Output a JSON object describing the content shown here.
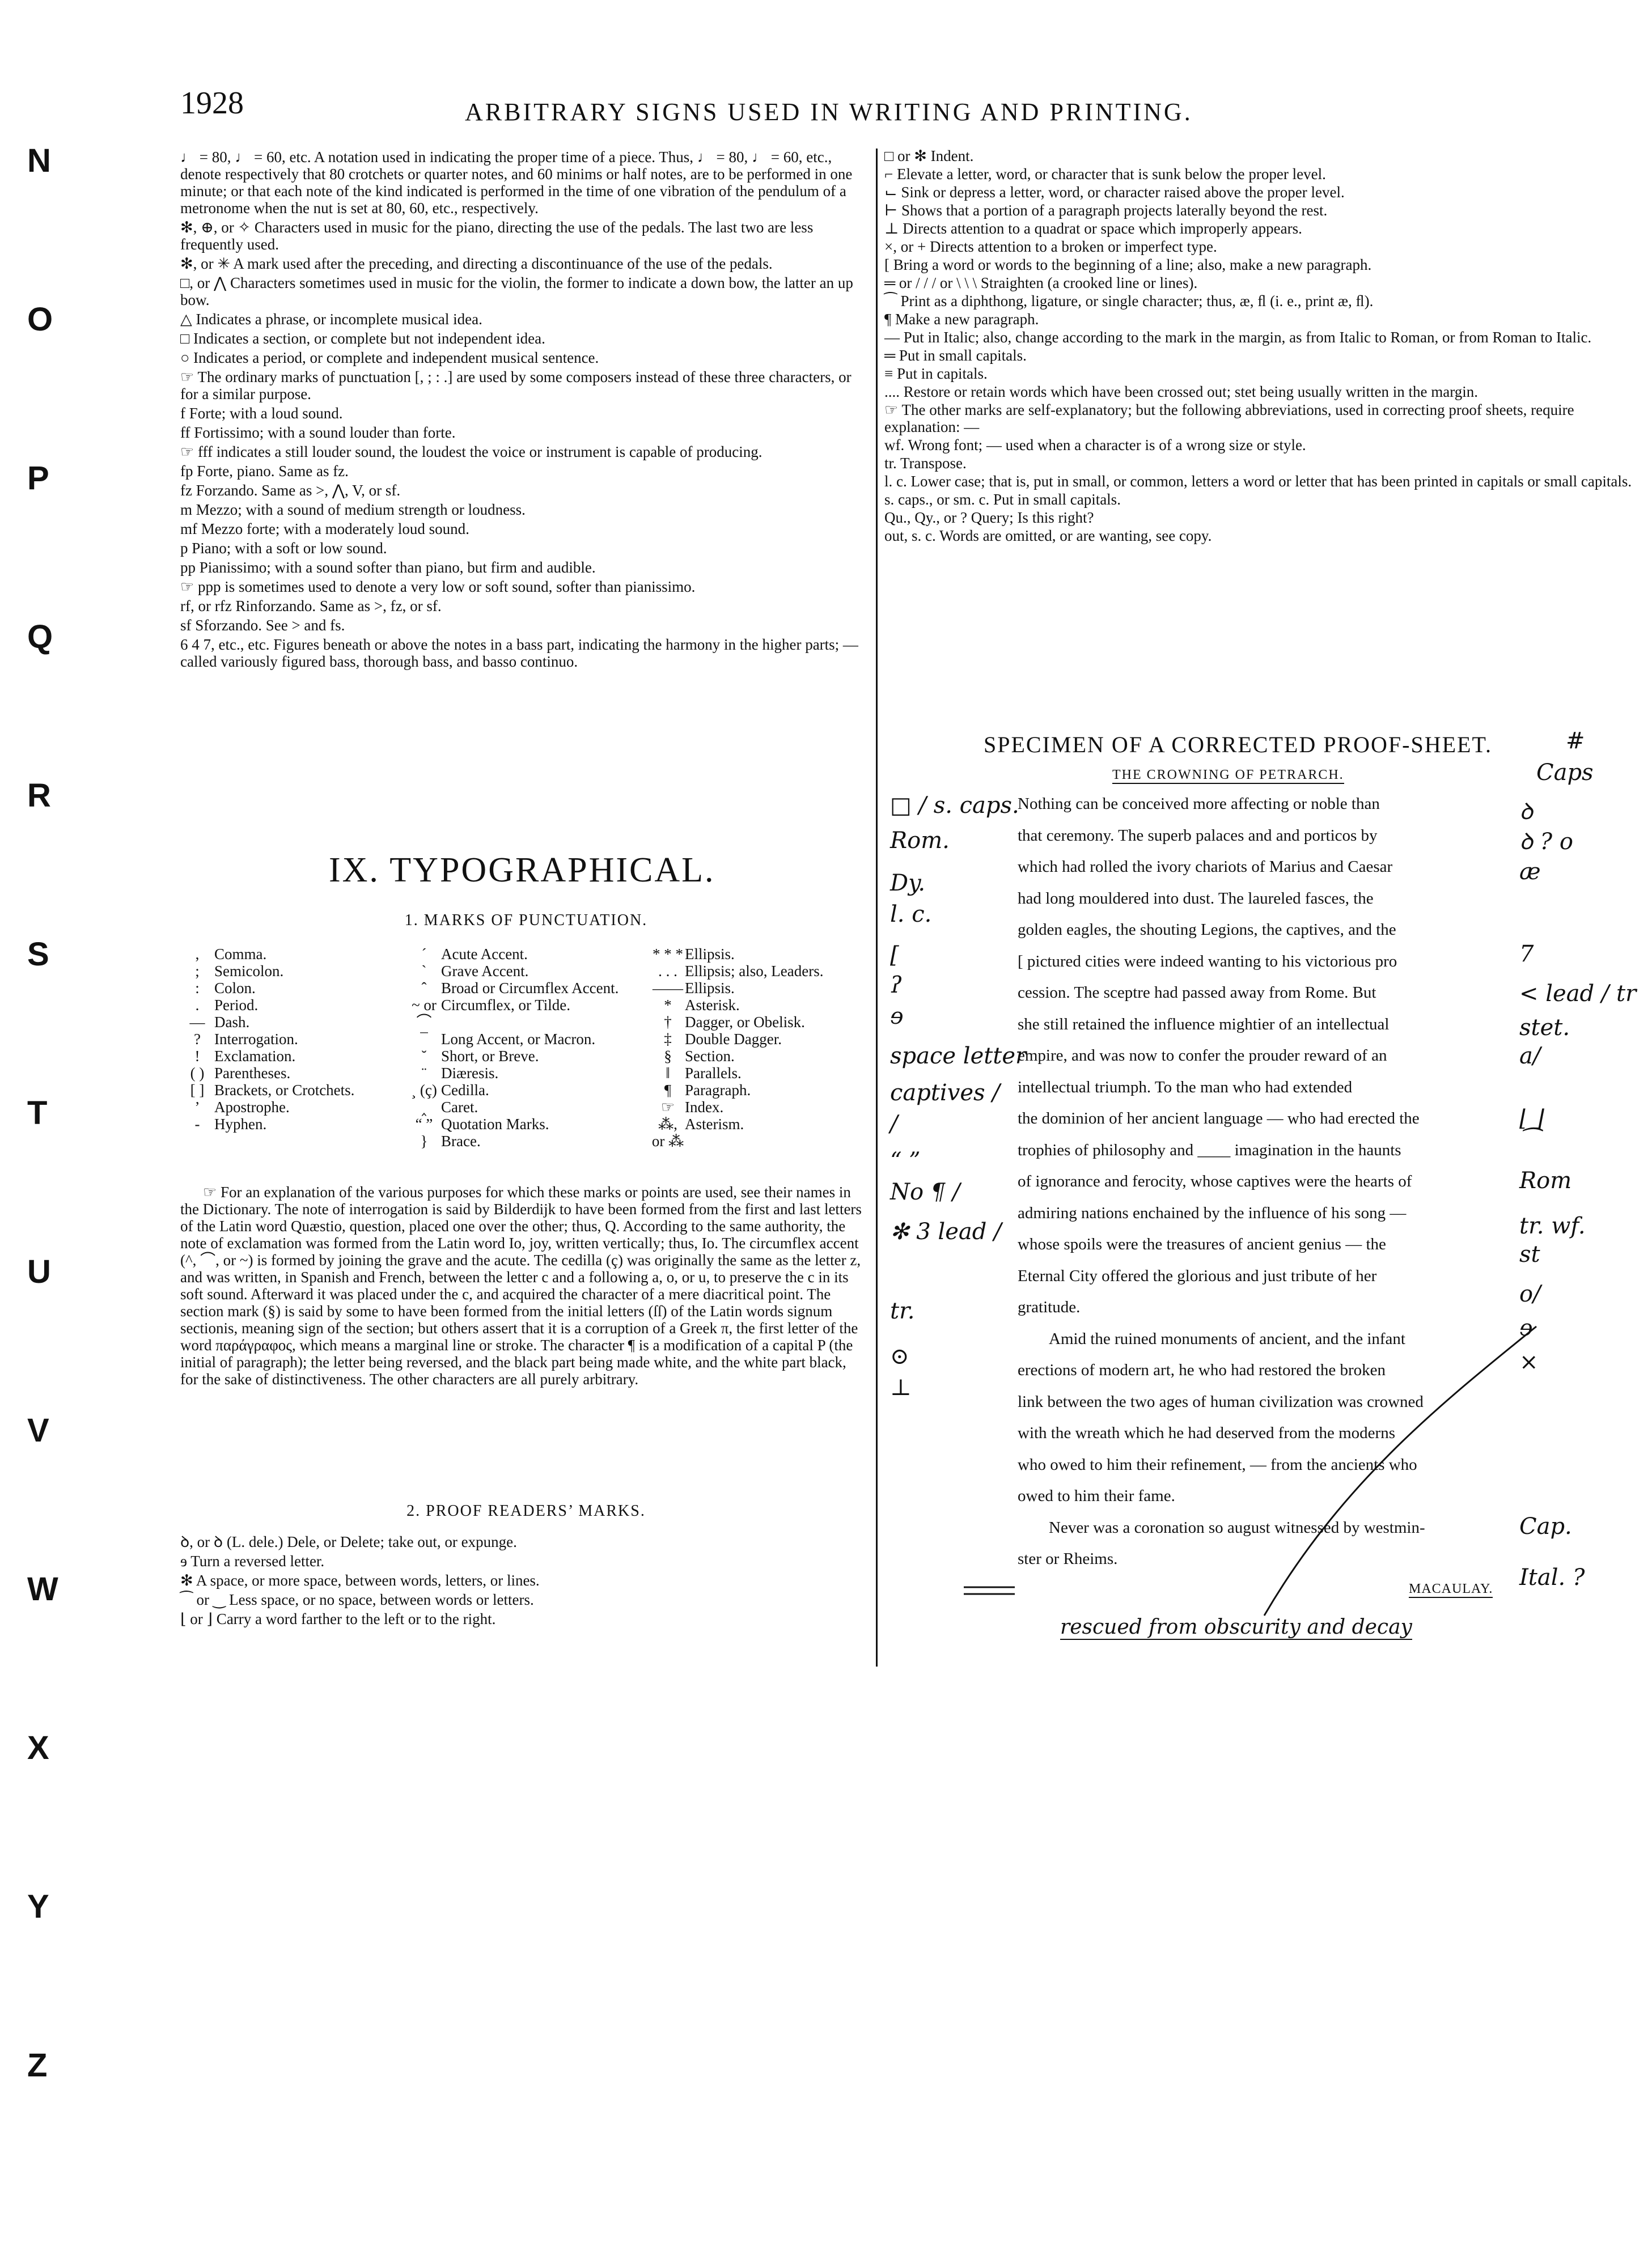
{
  "header": {
    "page_number": "1928",
    "running_head": "ARBITRARY SIGNS USED IN WRITING AND PRINTING."
  },
  "thumb_index": [
    "N",
    "O",
    "P",
    "Q",
    "R",
    "S",
    "T",
    "U",
    "V",
    "W",
    "X",
    "Y",
    "Z"
  ],
  "left_column": {
    "music": [
      "♩ = 80, ♩ = 60, etc.   A notation used in indicating the proper time of a piece. Thus, ♩ = 80, ♩ = 60, etc., denote respectively that 80 crotchets or quarter notes, and 60 minims or half notes, are to be performed in one minute; or that each note of the kind indicated is performed in the time of one vibration of the pendulum of a metronome when the nut is set at 80, 60, etc., respectively.",
      "✻, ⊕, or ✧   Characters used in music for the piano, directing the use of the pedals. The last two are less frequently used.",
      "✻, or ✳   A mark used after the preceding, and directing a discontinuance of the use of the pedals.",
      "□, or ⋀   Characters sometimes used in music for the violin, the former to indicate a down bow, the latter an up bow.",
      "△  Indicates a phrase, or incomplete musical idea.",
      "□  Indicates a section, or complete but not independent idea.",
      "○  Indicates a period, or complete and independent musical sentence.",
      "☞ The ordinary marks of punctuation [, ; : .] are used by some composers instead of these three characters, or for a similar purpose.",
      "f   Forte; with a loud sound.",
      "ff  Fortissimo; with a sound louder than forte.",
      "☞ fff indicates a still louder sound, the loudest the voice or instrument is capable of producing.",
      "fp  Forte, piano. Same as fz.",
      "fz  Forzando. Same as >, ⋀, V, or sf.",
      "m  Mezzo; with a sound of medium strength or loudness.",
      "mf  Mezzo forte; with a moderately loud sound.",
      "p  Piano; with a soft or low sound.",
      "pp  Pianissimo; with a sound softer than piano, but firm and audible.",
      "☞ ppp is sometimes used to denote a very low or soft sound, softer than pianissimo.",
      "rf, or rfz  Rinforzando. Same as >, fz, or sf.",
      "sf  Sforzando. See > and fs.",
      "6 4 7, etc., etc.  Figures beneath or above the notes in a bass part, indicating the harmony in the higher parts; — called variously figured bass, thorough bass, and basso continuo."
    ],
    "section_title": "IX. TYPOGRAPHICAL.",
    "sub1": "1. MARKS OF PUNCTUATION.",
    "punct_col1": [
      [
        ",",
        "Comma."
      ],
      [
        ";",
        "Semicolon."
      ],
      [
        ":",
        "Colon."
      ],
      [
        ".",
        "Period."
      ],
      [
        "—",
        "Dash."
      ],
      [
        "?",
        "Interrogation."
      ],
      [
        "!",
        "Exclamation."
      ],
      [
        "( )",
        "Parentheses."
      ],
      [
        "[ ]",
        "Brackets, or Crotchets."
      ],
      [
        "’",
        "Apostrophe."
      ],
      [
        "-",
        "Hyphen."
      ]
    ],
    "punct_col2": [
      [
        "´",
        "Acute Accent."
      ],
      [
        "`",
        "Grave Accent."
      ],
      [
        "ˆ",
        "Broad or Circumflex Accent."
      ],
      [
        "~ or ⌒",
        "Circumflex, or Tilde."
      ],
      [
        "¯",
        "Long Accent, or Macron."
      ],
      [
        "˘",
        "Short, or Breve."
      ],
      [
        "¨",
        "Diæresis."
      ],
      [
        "¸ (ç)",
        "Cedilla."
      ],
      [
        "‸",
        "Caret."
      ],
      [
        "“ ”",
        "Quotation Marks."
      ],
      [
        "}",
        "Brace."
      ]
    ],
    "punct_col3": [
      [
        "* * *",
        "Ellipsis."
      ],
      [
        ". . .",
        "Ellipsis; also, Leaders."
      ],
      [
        "——",
        "Ellipsis."
      ],
      [
        "*",
        "Asterisk."
      ],
      [
        "†",
        "Dagger, or Obelisk."
      ],
      [
        "‡",
        "Double Dagger."
      ],
      [
        "§",
        "Section."
      ],
      [
        "‖",
        "Parallels."
      ],
      [
        "¶",
        "Paragraph."
      ],
      [
        "☞",
        "Index."
      ],
      [
        "⁂, or ⁂",
        "Asterism."
      ]
    ],
    "explanation": "☞ For an explanation of the various purposes for which these marks or points are used, see their names in the Dictionary. The note of interrogation is said by Bilderdijk to have been formed from the first and last letters of the Latin word Quæstio, question, placed one over the other; thus, Q. According to the same authority, the note of exclamation was formed from the Latin word Io, joy, written vertically; thus, Io. The circumflex accent (^, ⌒, or ~) is formed by joining the grave and the acute. The cedilla (ç) was originally the same as the letter z, and was written, in Spanish and French, between the letter c and a following a, o, or u, to preserve the c in its soft sound. Afterward it was placed under the c, and acquired the character of a mere diacritical point. The section mark (§) is said by some to have been formed from the initial letters (ſſ) of the Latin words signum sectionis, meaning sign of the section; but others assert that it is a corruption of a Greek π, the first letter of the word παράγραφος, which means a marginal line or stroke. The character ¶ is a modification of a capital P (the initial of paragraph); the letter being reversed, and the black part being made white, and the white part black, for the sake of distinctiveness. The other characters are all purely arbitrary.",
    "sub2": "2. PROOF READERS’ MARKS.",
    "proof_marks": [
      "ꝺ, or ꝺ  (L. dele.)  Dele, or Delete; take out, or expunge.",
      "ɘ  Turn a reversed letter.",
      "✻  A space, or more space, between words, letters, or lines.",
      "⁀ or ‿  Less space, or no space, between words or letters.",
      "⌊ or ⌋  Carry a word farther to the left or to the right."
    ]
  },
  "right_column": {
    "marks": [
      "□ or ✻  Indent.",
      "⌐  Elevate a letter, word, or character that is sunk below the proper level.",
      "⌙  Sink or depress a letter, word, or character raised above the proper level.",
      "⊢  Shows that a portion of a paragraph projects laterally beyond the rest.",
      "⊥  Directs attention to a quadrat or space which improperly appears.",
      "×, or +  Directs attention to a broken or imperfect type.",
      "[  Bring a word or words to the beginning of a line; also, make a new paragraph.",
      "═ or / / / or \\ \\ \\  Straighten (a crooked line or lines).",
      "⁀  Print as a diphthong, ligature, or single character; thus, æ, ﬂ (i. e., print æ, ﬂ).",
      "¶  Make a new paragraph.",
      "—  Put in Italic; also, change according to the mark in the margin, as from Italic to Roman, or from Roman to Italic.",
      "═  Put in small capitals.",
      "≡  Put in capitals.",
      "....  Restore or retain words which have been crossed out; stet being usually written in the margin.",
      "☞ The other marks are self-explanatory; but the following abbreviations, used in correcting proof sheets, require explanation: —",
      "wf.  Wrong font; — used when a character is of a wrong size or style.",
      "tr.  Transpose.",
      "l. c.  Lower case; that is, put in small, or common, letters a word or letter that has been printed in capitals or small capitals.",
      "s. caps., or sm. c.  Put in small capitals.",
      "Qu., Qy., or ?  Query; Is this right?",
      "out, s. c.  Words are omitted, or are wanting, see copy."
    ],
    "specimen_title": "SPECIMEN OF A CORRECTED PROOF-SHEET.",
    "specimen_sub": "THE CROWNING OF PETRARCH.",
    "specimen_lines": [
      "Nothing can be conceived more affecting or noble than",
      "that ceremony. The superb palaces and and porticos by",
      "which had rolled the ivory chariots of Marius and Caesar",
      "had long mouldered into dust. The laureled fasces, the",
      "golden eagles, the shouting Legions, the captives, and the",
      "[ pictured cities were indeed wanting to his victorious pro",
      "cession. The sceptre had passed away from Rome. But",
      "she still retained the influence mightier of an intellectual",
      "empire, and was now to confer the prouder reward of an",
      "intellectual triumph. To the man who had extended",
      "the dominion of her ancient language — who had erected the",
      "trophies of philosophy and ____ imagination in the haunts",
      "of ignorance and ferocity, whose captives were the hearts of",
      "admiring nations enchained by the influence of his song —",
      "whose spoils were the treasures of ancient genius — the",
      "Eternal City offered the glorious and just tribute of her",
      "gratitude.",
      "Amid the ruined monuments of ancient, and the infant",
      "erections of modern art, he who had restored the broken",
      "link between the two ages of human civilization was crowned",
      "with the wreath which he had deserved from the moderns",
      "who owed to him their refinement, — from the ancients who",
      "owed to him their fame.",
      "Never was a coronation so august witnessed by westmin-",
      "ster or Rheims."
    ],
    "attribution": "MACAULAY.",
    "left_marks": [
      "□ / s. caps.",
      "Rom.",
      "Dy.",
      "l. c.",
      "[",
      "ʔ",
      "ɘ",
      "space letter",
      "captives /",
      "/",
      "“ ”",
      "No ¶ /",
      "✻ 3 lead /",
      "tr.",
      "⊙",
      "⊥"
    ],
    "right_marks": [
      "ꝺ",
      "ꝺ ? o",
      "æ",
      "7",
      "< lead / tr",
      "stet.",
      "a/",
      "⌊ ⌋",
      "⁀",
      "Rom",
      "tr. wf.",
      "st",
      "o/",
      "ɘ",
      "×",
      "Cap.",
      "Ital. ?"
    ],
    "handwritten_note": "rescued from obscurity and decay",
    "caps_mark": "Caps",
    "hash_mark": "#"
  }
}
